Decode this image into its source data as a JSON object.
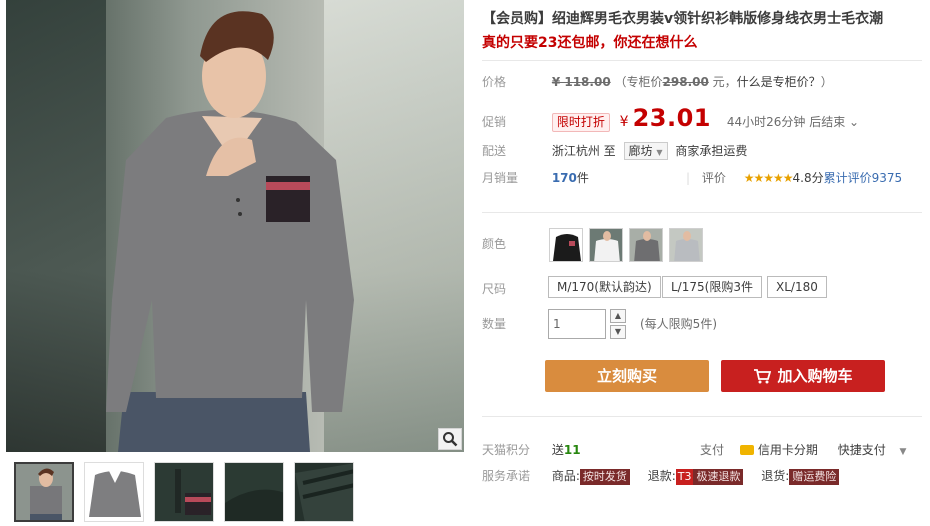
{
  "product": {
    "title": "【会员购】绍迪辉男毛衣男装v领针织衫韩版修身线衣男士毛衣潮",
    "subtitle": "真的只要23还包邮，你还在想什么"
  },
  "price": {
    "label": "价格",
    "original": "¥ 118.00",
    "counter_open": "（专柜价",
    "counter_price": "298.00",
    "counter_unit": "元，",
    "counter_link": "什么是专柜价？",
    "counter_close": "）"
  },
  "promo": {
    "label": "促销",
    "badge": "限时打折",
    "currency": "¥",
    "price": "23.01",
    "countdown": "44小时26分钟 后结束"
  },
  "shipping": {
    "label": "配送",
    "from": "浙江杭州",
    "to_word": "至",
    "destination": "廊坊",
    "note": "商家承担运费"
  },
  "sales": {
    "label": "月销量",
    "count": "170",
    "unit": "件",
    "rating_label": "评价",
    "stars": "★★★★★",
    "score": "4.8分",
    "reviews_link": "累计评价9375"
  },
  "color": {
    "label": "颜色",
    "swatches": [
      "black-sweater",
      "white-sweater",
      "grey-sweater-model",
      "light-grey-sweater-model"
    ]
  },
  "size": {
    "label": "尺码",
    "options": [
      "M/170(默认韵达)",
      "L/175(限购3件",
      "XL/180"
    ]
  },
  "quantity": {
    "label": "数量",
    "value": "1",
    "limit_note": "(每人限购5件)"
  },
  "actions": {
    "buy": "立刻购买",
    "cart": "加入购物车"
  },
  "points": {
    "label": "天猫积分",
    "give": "送",
    "value": "11",
    "pay_label": "支付",
    "card_pay": "信用卡分期",
    "quick_pay": "快捷支付"
  },
  "service": {
    "label": "服务承诺",
    "goods": "商品:",
    "goods_tag": "按时发货",
    "refund": "退款:",
    "refund_tag_prefix": "T3",
    "refund_tag": "极速退款",
    "return": "退货:",
    "return_tag": "赠运费险"
  },
  "icons": {
    "zoom": "magnifier-icon",
    "cart": "cart-icon",
    "dropdown": "chevron-down-icon"
  },
  "colors": {
    "accent_red": "#c40000",
    "buy_orange": "#d98c3e",
    "cart_red": "#c8201f"
  }
}
